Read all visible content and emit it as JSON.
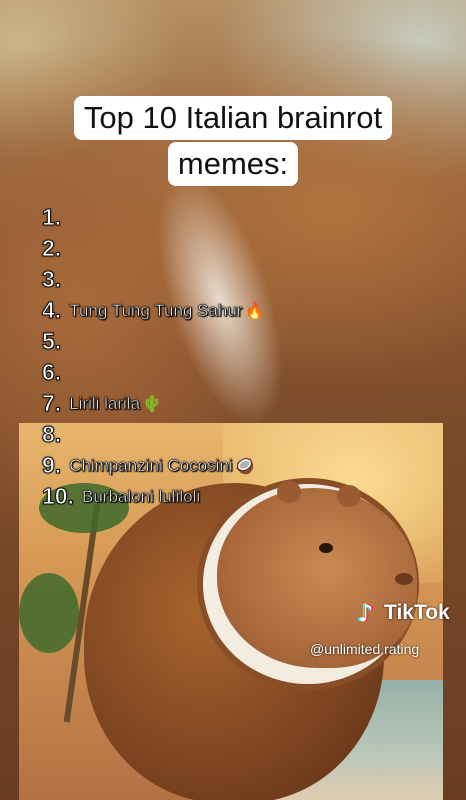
{
  "title": {
    "line1": "Top 10 Italian brainrot",
    "line2": "memes:"
  },
  "list": [
    {
      "number": "1.",
      "label": "",
      "emoji": ""
    },
    {
      "number": "2.",
      "label": "",
      "emoji": ""
    },
    {
      "number": "3.",
      "label": "",
      "emoji": ""
    },
    {
      "number": "4.",
      "label": "Tung Tung Tung Sahur",
      "emoji": "🔥"
    },
    {
      "number": "5.",
      "label": "",
      "emoji": ""
    },
    {
      "number": "6.",
      "label": "",
      "emoji": ""
    },
    {
      "number": "7.",
      "label": "Lirili larila",
      "emoji": "🌵"
    },
    {
      "number": "8.",
      "label": "",
      "emoji": ""
    },
    {
      "number": "9.",
      "label": "Chimpanzini Cocosini",
      "emoji": "🥥"
    },
    {
      "number": "10.",
      "label": "Burbaloni luliloli",
      "emoji": ""
    }
  ],
  "watermark": {
    "brand": "TikTok",
    "handle": "@unlimited.rating",
    "icon": "tiktok-note-icon"
  },
  "colors": {
    "title_bg": "#ffffff",
    "text": "#ffffff",
    "outline": "#111111"
  }
}
